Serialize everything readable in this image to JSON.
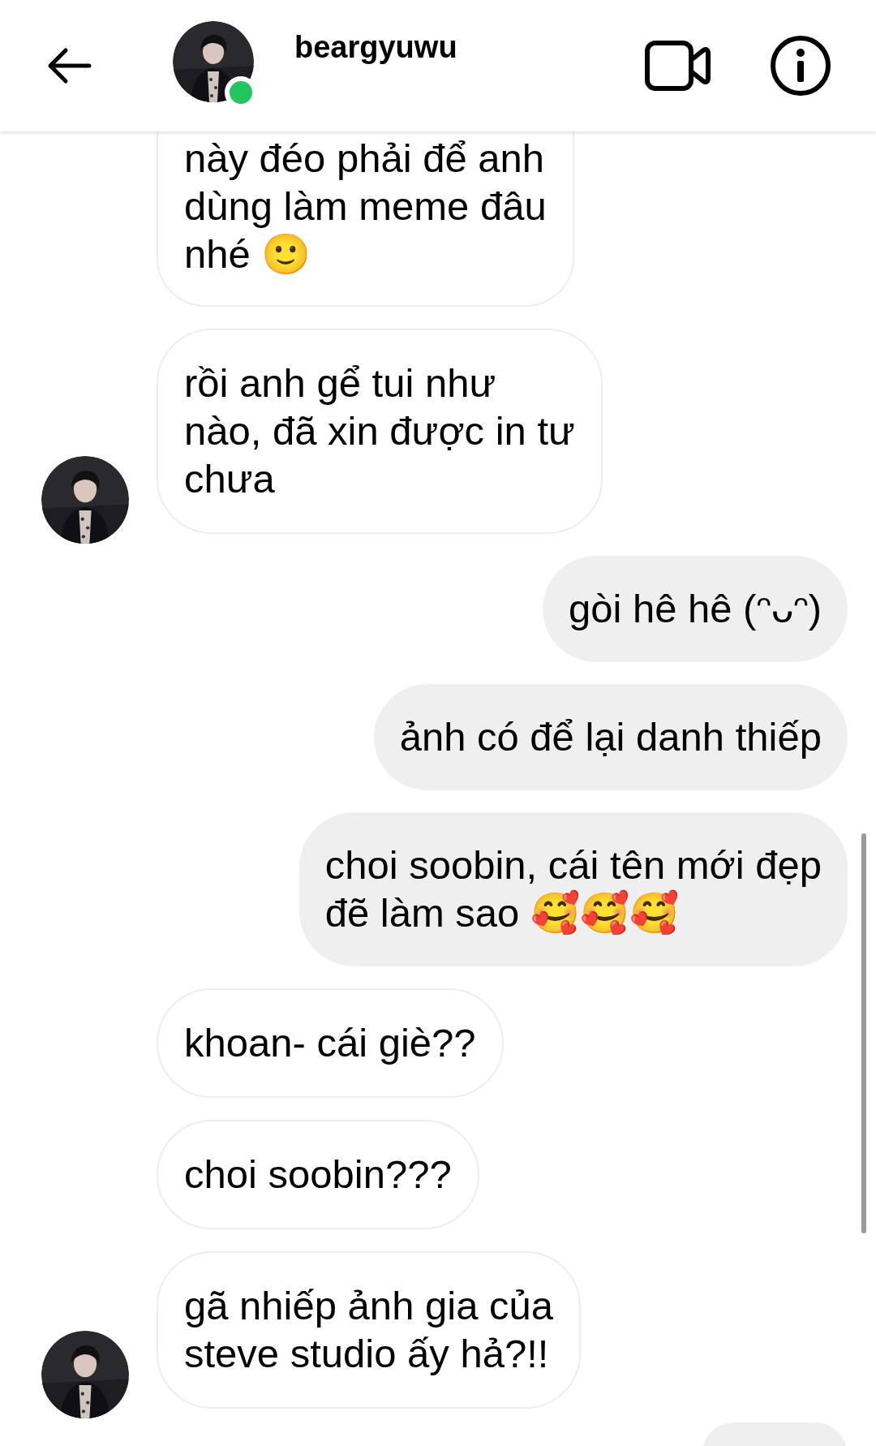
{
  "header": {
    "username": "beargyuwu",
    "online": true
  },
  "messages": [
    {
      "kind": "received",
      "clipped_top": true,
      "avatar": false,
      "lines": [
        "này đéo phải để anh",
        "dùng làm meme đâu",
        "nhé 🙂"
      ]
    },
    {
      "kind": "received",
      "clipped_top": false,
      "avatar": true,
      "lines": [
        "rồi anh gể tui như",
        "nào, đã xin được in tư",
        "chưa"
      ]
    },
    {
      "kind": "sent",
      "clipped_top": false,
      "lines": [
        "gòi hê hê (ᵔᴗᵔ)"
      ]
    },
    {
      "kind": "sent",
      "clipped_top": false,
      "lines": [
        "ảnh có để lại danh thiếp"
      ]
    },
    {
      "kind": "sent",
      "clipped_top": false,
      "lines": [
        "choi soobin, cái tên mới đẹp",
        "đẽ làm sao 🥰🥰🥰"
      ]
    },
    {
      "kind": "received",
      "clipped_top": false,
      "avatar": false,
      "lines": [
        "khoan- cái giè??"
      ]
    },
    {
      "kind": "received",
      "clipped_top": false,
      "avatar": false,
      "lines": [
        "choi soobin???"
      ]
    },
    {
      "kind": "received",
      "clipped_top": false,
      "avatar": true,
      "lines": [
        "gã nhiếp ảnh gia của",
        "steve studio ấy hả?!!"
      ]
    }
  ]
}
